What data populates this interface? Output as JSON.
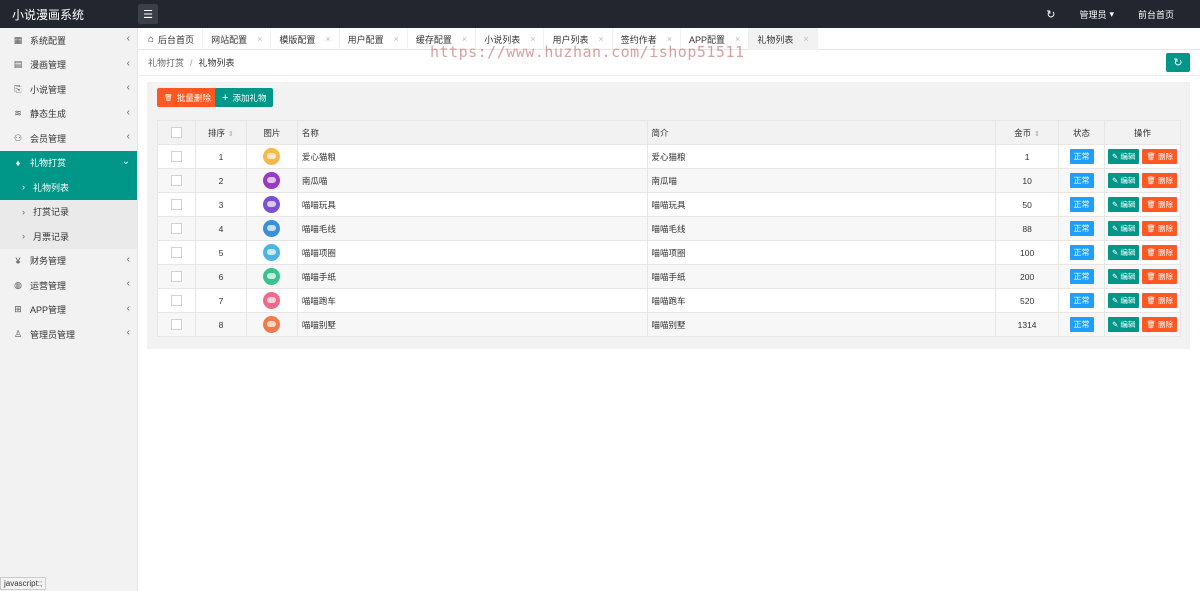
{
  "app": {
    "title": "小说漫画系统",
    "menu_toggle_glyph": "☰",
    "refresh_glyph": "↻",
    "admin_label": "管理员",
    "admin_caret": "▾",
    "frontend_label": "前台首页"
  },
  "sidebar": {
    "items": [
      {
        "icon": "system-config-icon",
        "glyph": "▦",
        "label": "系统配置",
        "chevron": "‹"
      },
      {
        "icon": "comic-icon",
        "glyph": "▤",
        "label": "漫画管理",
        "chevron": "‹"
      },
      {
        "icon": "book-icon",
        "glyph": "⎘",
        "label": "小说管理",
        "chevron": "‹"
      },
      {
        "icon": "layers-icon",
        "glyph": "≋",
        "label": "静态生成",
        "chevron": "‹"
      },
      {
        "icon": "members-icon",
        "glyph": "⚇",
        "label": "会员管理",
        "chevron": "‹"
      },
      {
        "icon": "diamond-icon",
        "glyph": "♦",
        "label": "礼物打赏",
        "chevron": "⌄"
      }
    ],
    "sub_items": [
      {
        "label": "礼物列表",
        "arrow": "›"
      },
      {
        "label": "打赏记录",
        "arrow": "›"
      },
      {
        "label": "月票记录",
        "arrow": "›"
      }
    ],
    "items_after": [
      {
        "icon": "finance-icon",
        "glyph": "¥",
        "label": "财务管理",
        "chevron": "‹"
      },
      {
        "icon": "globe-icon",
        "glyph": "◍",
        "label": "运营管理",
        "chevron": "‹"
      },
      {
        "icon": "windows-icon",
        "glyph": "⊞",
        "label": "APP管理",
        "chevron": "‹"
      },
      {
        "icon": "user-icon",
        "glyph": "♙",
        "label": "管理员管理",
        "chevron": "‹"
      }
    ]
  },
  "tabs": [
    {
      "label": "后台首页",
      "close": ""
    },
    {
      "label": "网站配置",
      "close": "×"
    },
    {
      "label": "模版配置",
      "close": "×"
    },
    {
      "label": "用户配置",
      "close": "×"
    },
    {
      "label": "缓存配置",
      "close": "×"
    },
    {
      "label": "小说列表",
      "close": "×"
    },
    {
      "label": "用户列表",
      "close": "×"
    },
    {
      "label": "签约作者",
      "close": "×"
    },
    {
      "label": "APP配置",
      "close": "×"
    },
    {
      "label": "礼物列表",
      "close": "×"
    }
  ],
  "home_glyph": "⌂",
  "watermark": "https://www.huzhan.com/ishop51511",
  "breadcrumb": {
    "parent": "礼物打赏",
    "separator": "/",
    "current": "礼物列表"
  },
  "toolbar": {
    "batch_delete": "批量删除",
    "batch_delete_glyph": "🗑",
    "add_gift": "添加礼物",
    "add_gift_glyph": "+"
  },
  "table": {
    "headers": {
      "sort": "排序",
      "image": "图片",
      "name": "名称",
      "desc": "简介",
      "coins": "金币",
      "status": "状态",
      "ops": "操作"
    },
    "sort_glyph": "⇕",
    "edit_label": "✎ 编辑",
    "delete_label": "🗑 删除",
    "rows": [
      {
        "sort": "1",
        "color": "#f4b94a",
        "name": "爱心猫粮",
        "desc": "爱心猫粮",
        "coins": "1",
        "status": "正常"
      },
      {
        "sort": "2",
        "color": "#9b38c4",
        "name": "南瓜喵",
        "desc": "南瓜喵",
        "coins": "10",
        "status": "正常"
      },
      {
        "sort": "3",
        "color": "#7b4fd8",
        "name": "喵喵玩具",
        "desc": "喵喵玩具",
        "coins": "50",
        "status": "正常"
      },
      {
        "sort": "4",
        "color": "#3a8fd8",
        "name": "喵喵毛线",
        "desc": "喵喵毛线",
        "coins": "88",
        "status": "正常"
      },
      {
        "sort": "5",
        "color": "#4cb3e6",
        "name": "喵喵项圈",
        "desc": "喵喵项圈",
        "coins": "100",
        "status": "正常"
      },
      {
        "sort": "6",
        "color": "#39c28a",
        "name": "喵喵手纸",
        "desc": "喵喵手纸",
        "coins": "200",
        "status": "正常"
      },
      {
        "sort": "7",
        "color": "#ef6a8a",
        "name": "喵喵跑车",
        "desc": "喵喵跑车",
        "coins": "520",
        "status": "正常"
      },
      {
        "sort": "8",
        "color": "#f07a4a",
        "name": "喵喵别墅",
        "desc": "喵喵别墅",
        "coins": "1314",
        "status": "正常"
      }
    ]
  },
  "status_bar": "javascript:;"
}
